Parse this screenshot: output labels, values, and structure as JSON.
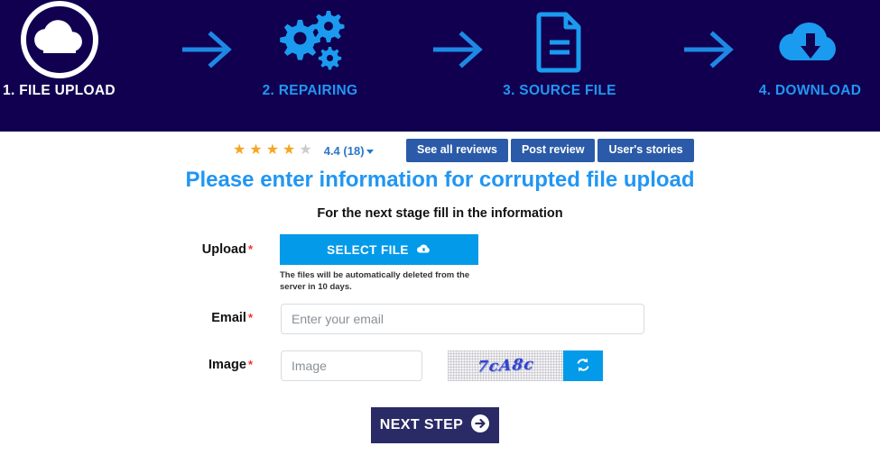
{
  "steps": [
    {
      "label": "1. FILE UPLOAD",
      "icon": "cloud-upload-circle-icon",
      "state": "active"
    },
    {
      "label": "2. REPAIRING",
      "icon": "gears-icon",
      "state": "inactive"
    },
    {
      "label": "3. SOURCE FILE",
      "icon": "document-icon",
      "state": "inactive"
    },
    {
      "label": "4. DOWNLOAD",
      "icon": "cloud-download-icon",
      "state": "inactive"
    }
  ],
  "reviews": {
    "stars_filled": 4,
    "stars_total": 5,
    "rating_text": "4.4 (18)",
    "buttons": [
      {
        "label": "See all reviews"
      },
      {
        "label": "Post review"
      },
      {
        "label": "User's stories"
      }
    ]
  },
  "headings": {
    "title": "Please enter information for corrupted file upload",
    "subtitle": "For the next stage fill in the information"
  },
  "form": {
    "upload": {
      "label": "Upload",
      "required_marker": "*",
      "button_label": "SELECT FILE",
      "note": "The files will be automatically deleted from the server in 10 days."
    },
    "email": {
      "label": "Email",
      "required_marker": "*",
      "placeholder": "Enter your email",
      "value": ""
    },
    "image": {
      "label": "Image",
      "required_marker": "*",
      "placeholder": "Image",
      "value": "",
      "captcha_text": "7cA8c",
      "refresh_icon": "refresh-icon"
    },
    "submit_label": "NEXT STEP"
  },
  "colors": {
    "header_bg": "#110050",
    "accent_blue": "#2196f3",
    "button_blue": "#039ae9",
    "review_blue": "#2b5ba8",
    "star_gold": "#f5a623",
    "star_grey": "#cccccc",
    "required_red": "#ff2b2b",
    "submit_navy": "#2a2a66"
  }
}
